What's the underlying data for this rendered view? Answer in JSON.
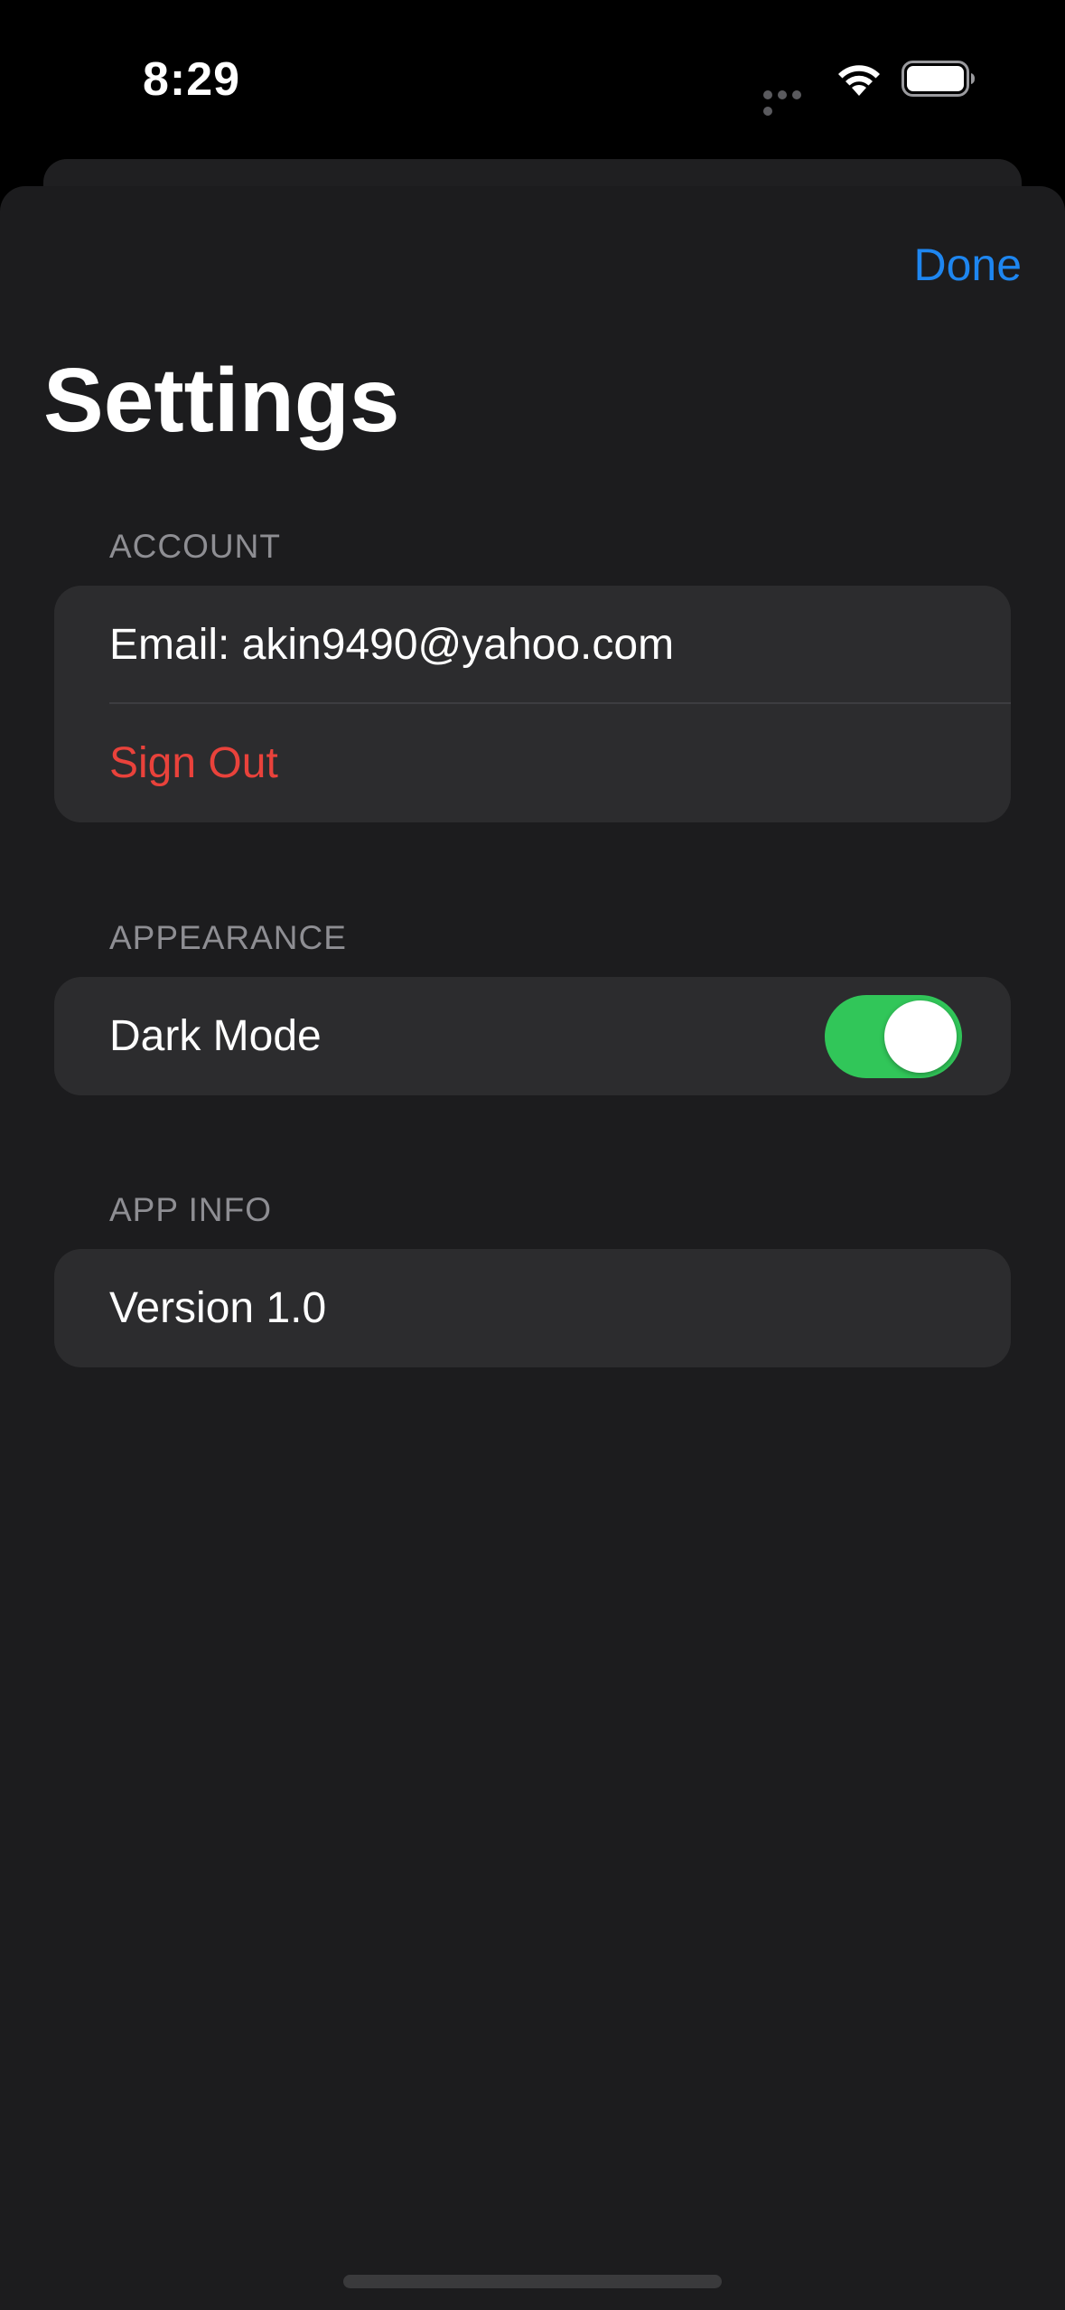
{
  "status_bar": {
    "time": "8:29",
    "wifi_icon": "wifi-icon",
    "battery_icon": "battery-full-icon"
  },
  "nav": {
    "done_label": "Done"
  },
  "page": {
    "title": "Settings"
  },
  "sections": {
    "account": {
      "header": "ACCOUNT",
      "email_row": "Email: akin9490@yahoo.com",
      "sign_out_label": "Sign Out"
    },
    "appearance": {
      "header": "APPEARANCE",
      "dark_mode_label": "Dark Mode",
      "dark_mode_on": true
    },
    "app_info": {
      "header": "APP INFO",
      "version_row": "Version 1.0"
    }
  },
  "colors": {
    "accent": "#1e86f0",
    "destructive": "#e9423b",
    "toggle_on": "#31c659",
    "background": "#1c1c1e",
    "cell": "#2c2c2e"
  }
}
